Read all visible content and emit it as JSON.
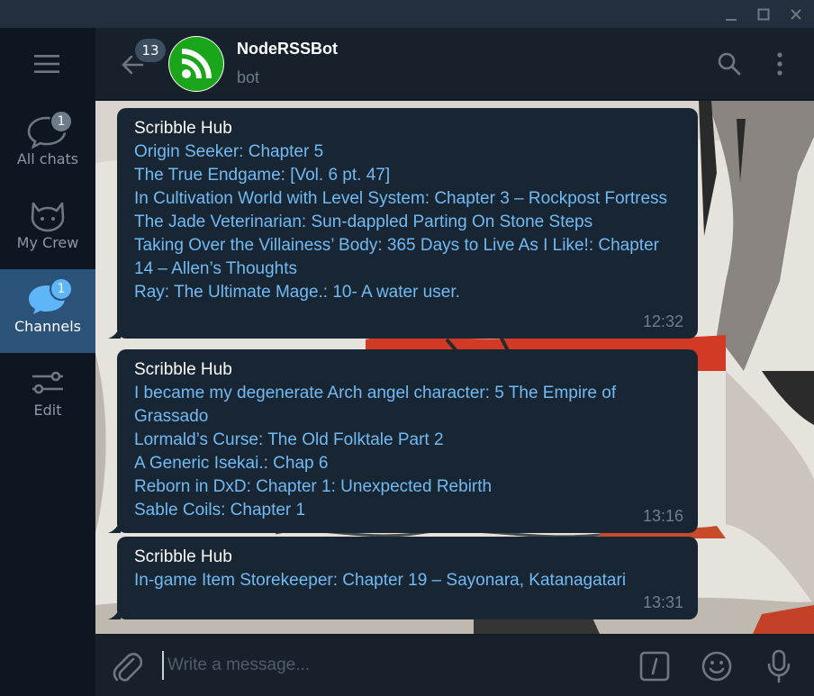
{
  "window": {
    "minimize_icon": "minimize-icon",
    "maximize_icon": "maximize-icon",
    "close_icon": "close-icon"
  },
  "sidebar": {
    "menu_icon": "hamburger-menu-icon",
    "folders": [
      {
        "label": "All chats",
        "badge": "1",
        "icon": "chat-bubbles-icon",
        "active": false
      },
      {
        "label": "My Crew",
        "badge": "",
        "icon": "cat-icon",
        "active": false
      },
      {
        "label": "Channels",
        "badge": "1",
        "icon": "channel-bubble-icon",
        "active": true
      },
      {
        "label": "Edit",
        "badge": "",
        "icon": "sliders-icon",
        "active": false
      }
    ]
  },
  "header": {
    "back_badge": "13",
    "title": "NodeRSSBot",
    "subtitle": "bot",
    "avatar_icon": "rss-icon",
    "avatar_color": "#1aa51a"
  },
  "messages": [
    {
      "sender": "Scribble Hub",
      "lines": [
        "Origin Seeker: Chapter 5",
        "The True Endgame: [Vol. 6 pt. 47]",
        "In Cultivation World with Level System: Chapter 3 – Rockpost Fortress",
        "The Jade Veterinarian: Sun-dappled Parting On Stone Steps",
        "Taking Over the Villainess’ Body: 365 Days to Live As I Like!: Chapter 14 – Allen’s Thoughts",
        "Ray: The Ultimate Mage.: 10- A water user."
      ],
      "time": "12:32"
    },
    {
      "sender": "Scribble Hub",
      "lines": [
        "I became my degenerate Arch angel character: 5 The Empire of Grassado",
        "Lormald’s Curse: The Old Folktale Part 2",
        "A Generic Isekai.: Chap 6",
        "Reborn in DxD: Chapter 1: Unexpected Rebirth",
        "Sable Coils: Chapter 1"
      ],
      "time": "13:16"
    },
    {
      "sender": "Scribble Hub",
      "lines": [
        "In-game Item Storekeeper: Chapter 19 – Sayonara, Katanagatari"
      ],
      "time": "13:31"
    }
  ],
  "composer": {
    "placeholder": "Write a message...",
    "value": ""
  },
  "colors": {
    "accent": "#5eb5f7",
    "link": "#71baf3",
    "bubble": "#182533",
    "active_folder": "#2b5278"
  }
}
